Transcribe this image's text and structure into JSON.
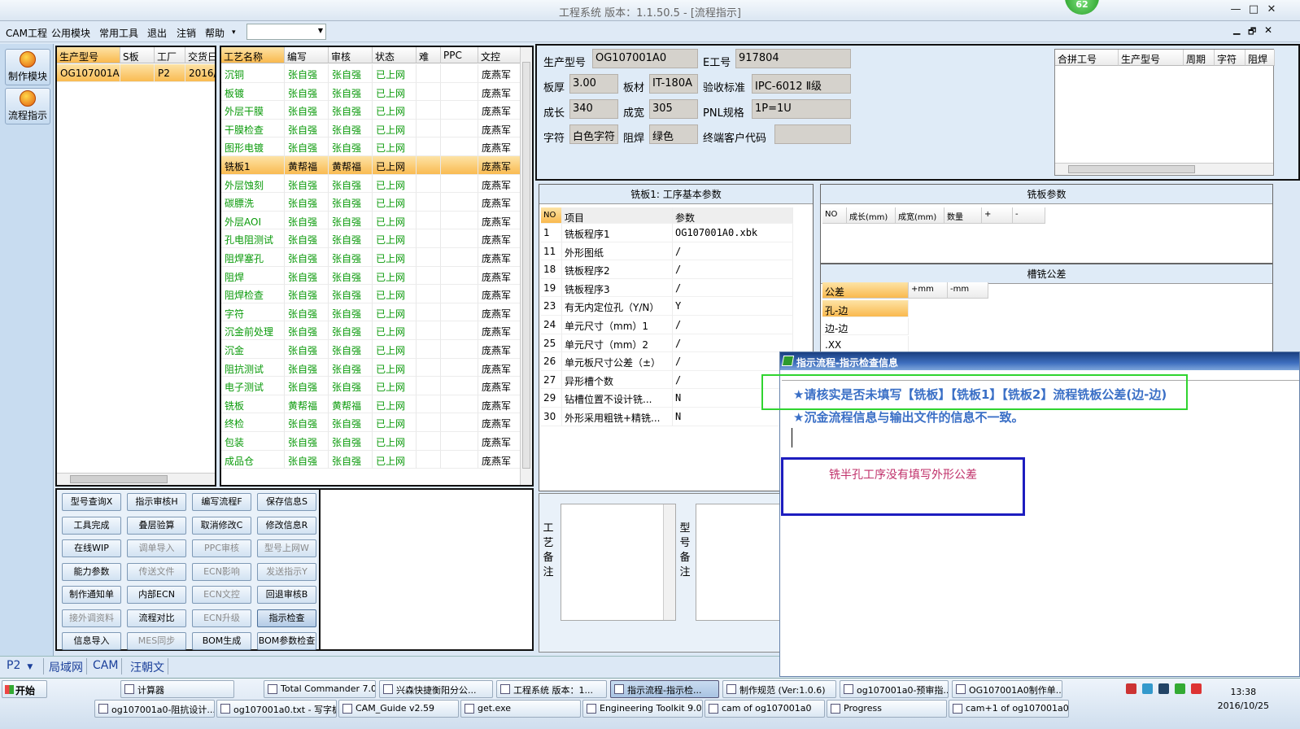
{
  "window": {
    "title": "工程系统  版本：1.1.50.5 - [流程指示]",
    "badge": "62",
    "ctrls": [
      "—",
      "□",
      "✕"
    ],
    "mdi_ctrls": [
      "▁",
      "🗗",
      "✕"
    ]
  },
  "menu": [
    "CAM工程",
    "公用模块",
    "常用工具",
    "退出",
    "注销",
    "帮助"
  ],
  "menu_arrow": "▾",
  "left_buttons": [
    {
      "label": "制作模块"
    },
    {
      "label": "流程指示"
    }
  ],
  "part_grid": {
    "headers": [
      "生产型号",
      "S板",
      "工厂",
      "交货日"
    ],
    "rows": [
      [
        "OG107001A0",
        "",
        "P2",
        "2016/"
      ]
    ]
  },
  "process_grid": {
    "headers": [
      "工艺名称",
      "编写",
      "审核",
      "状态",
      "难",
      "PPC",
      "文控"
    ],
    "rows": [
      [
        "沉铜",
        "张自强",
        "张自强",
        "已上网",
        "",
        "",
        "庞燕军"
      ],
      [
        "板镀",
        "张自强",
        "张自强",
        "已上网",
        "",
        "",
        "庞燕军"
      ],
      [
        "外层干膜",
        "张自强",
        "张自强",
        "已上网",
        "",
        "",
        "庞燕军"
      ],
      [
        "干膜检查",
        "张自强",
        "张自强",
        "已上网",
        "",
        "",
        "庞燕军"
      ],
      [
        "图形电镀",
        "张自强",
        "张自强",
        "已上网",
        "",
        "",
        "庞燕军"
      ],
      [
        "铣板1",
        "黄帮福",
        "黄帮福",
        "已上网",
        "",
        "",
        "庞燕军"
      ],
      [
        "外层蚀刻",
        "张自强",
        "张自强",
        "已上网",
        "",
        "",
        "庞燕军"
      ],
      [
        "碳膘洗",
        "张自强",
        "张自强",
        "已上网",
        "",
        "",
        "庞燕军"
      ],
      [
        "外层AOI",
        "张自强",
        "张自强",
        "已上网",
        "",
        "",
        "庞燕军"
      ],
      [
        "孔电阻测试",
        "张自强",
        "张自强",
        "已上网",
        "",
        "",
        "庞燕军"
      ],
      [
        "阻焊塞孔",
        "张自强",
        "张自强",
        "已上网",
        "",
        "",
        "庞燕军"
      ],
      [
        "阻焊",
        "张自强",
        "张自强",
        "已上网",
        "",
        "",
        "庞燕军"
      ],
      [
        "阻焊检查",
        "张自强",
        "张自强",
        "已上网",
        "",
        "",
        "庞燕军"
      ],
      [
        "字符",
        "张自强",
        "张自强",
        "已上网",
        "",
        "",
        "庞燕军"
      ],
      [
        "沉金前处理",
        "张自强",
        "张自强",
        "已上网",
        "",
        "",
        "庞燕军"
      ],
      [
        "沉金",
        "张自强",
        "张自强",
        "已上网",
        "",
        "",
        "庞燕军"
      ],
      [
        "阻抗测试",
        "张自强",
        "张自强",
        "已上网",
        "",
        "",
        "庞燕军"
      ],
      [
        "电子测试",
        "张自强",
        "张自强",
        "已上网",
        "",
        "",
        "庞燕军"
      ],
      [
        "铣板",
        "黄帮福",
        "黄帮福",
        "已上网",
        "",
        "",
        "庞燕军"
      ],
      [
        "终检",
        "张自强",
        "张自强",
        "已上网",
        "",
        "",
        "庞燕军"
      ],
      [
        "包装",
        "张自强",
        "张自强",
        "已上网",
        "",
        "",
        "庞燕军"
      ],
      [
        "成品仓",
        "张自强",
        "张自强",
        "已上网",
        "",
        "",
        "庞燕军"
      ]
    ]
  },
  "buttons": [
    [
      "型号查询X",
      "指示审核H",
      "编写流程F",
      "保存信息S"
    ],
    [
      "工具完成",
      "叠层验算",
      "取消修改C",
      "修改信息R"
    ],
    [
      "在线WIP",
      "调单导入",
      "PPC审核",
      "型号上网W"
    ],
    [
      "能力参数",
      "传送文件",
      "ECN影响",
      "发送指示Y"
    ],
    [
      "制作通知单",
      "内部ECN",
      "ECN文控",
      "回退审核B"
    ],
    [
      "接外调资料",
      "流程对比",
      "ECN升级",
      "指示检查"
    ],
    [
      "信息导入",
      "MES同步",
      "BOM生成",
      "BOM参数检查"
    ]
  ],
  "info": {
    "生产型号": "OG107001A0",
    "E工号": "917804",
    "板厚": "3.00",
    "板材": "IT-180A",
    "验收标准": "IPC-6012 Ⅱ级",
    "成长": "340",
    "成宽": "305",
    "PNL规格": "1P=1U",
    "字符": "白色字符",
    "阻焊": "绿色",
    "终端客户代码": ""
  },
  "info_labels": [
    "生产型号",
    "E工号",
    "板厚",
    "板材",
    "验收标准",
    "成长",
    "成宽",
    "PNL规格",
    "字符",
    "阻焊",
    "终端客户代码"
  ],
  "mini_grid": {
    "headers": [
      "合拼工号",
      "生产型号",
      "周期",
      "字符",
      "阻焊"
    ]
  },
  "params": {
    "title": "铣板1: 工序基本参数",
    "headers": [
      "NO",
      "项目",
      "参数"
    ],
    "rows": [
      [
        "1",
        "铣板程序1",
        "OG107001A0.xbk"
      ],
      [
        "11",
        "外形图纸",
        "/"
      ],
      [
        "18",
        "铣板程序2",
        "/"
      ],
      [
        "19",
        "铣板程序3",
        "/"
      ],
      [
        "23",
        "有无内定位孔（Y/N）",
        "Y"
      ],
      [
        "24",
        "单元尺寸（mm）1",
        "/"
      ],
      [
        "25",
        "单元尺寸（mm）2",
        "/"
      ],
      [
        "26",
        "单元板尺寸公差（±）",
        "/"
      ],
      [
        "27",
        "异形槽个数",
        "/"
      ],
      [
        "29",
        "钻槽位置不设计铣...",
        "N"
      ],
      [
        "30",
        "外形采用粗铣+精铣...",
        "N"
      ]
    ]
  },
  "mill": {
    "title": "铣板参数",
    "headers": [
      "NO",
      "成长(mm)",
      "成宽(mm)",
      "数量",
      "+",
      "-"
    ]
  },
  "slot": {
    "title": "槽铣公差",
    "headers": [
      "公差",
      "+mm",
      "-mm"
    ],
    "rows": [
      "孔-边",
      "边-边",
      ".XX"
    ]
  },
  "notes": {
    "process_label": "工艺备注",
    "part_label": "型号备注"
  },
  "dialog": {
    "title": "指示流程-指示检查信息",
    "lines": [
      "★请核实是否未填写【铣板】【铣板1】【铣板2】流程铣板公差(边-边)",
      "★沉金流程信息与输出文件的信息不一致。"
    ]
  },
  "annotation": "铣半孔工序没有填写外形公差",
  "bottom_tabs": [
    "P2",
    "局域网",
    "CAM",
    "汪朝文"
  ],
  "taskbar": {
    "start": "开始",
    "row1": [
      "计算器",
      "Total Commander 7.0...",
      "兴森快捷衡阳分公...",
      "工程系统  版本：1...",
      "指示流程-指示检...",
      "制作规范 (Ver:1.0.6)",
      "og107001a0-预审指...",
      "OG107001A0制作单..."
    ],
    "row2": [
      "og107001a0-阻抗设计...",
      "og107001a0.txt - 写字板",
      "CAM_Guide v2.59",
      "get.exe",
      "Engineering Toolkit 9.0...",
      "cam of og107001a0",
      "Progress",
      "cam+1 of og107001a0"
    ],
    "time": "13:38",
    "date": "2016/10/25"
  },
  "colors": {
    "accent_green": "#0a9a0a",
    "highlight": "#f9b94e",
    "dialog_text": "#3a6fc6",
    "annotation_text": "#c0306a"
  }
}
